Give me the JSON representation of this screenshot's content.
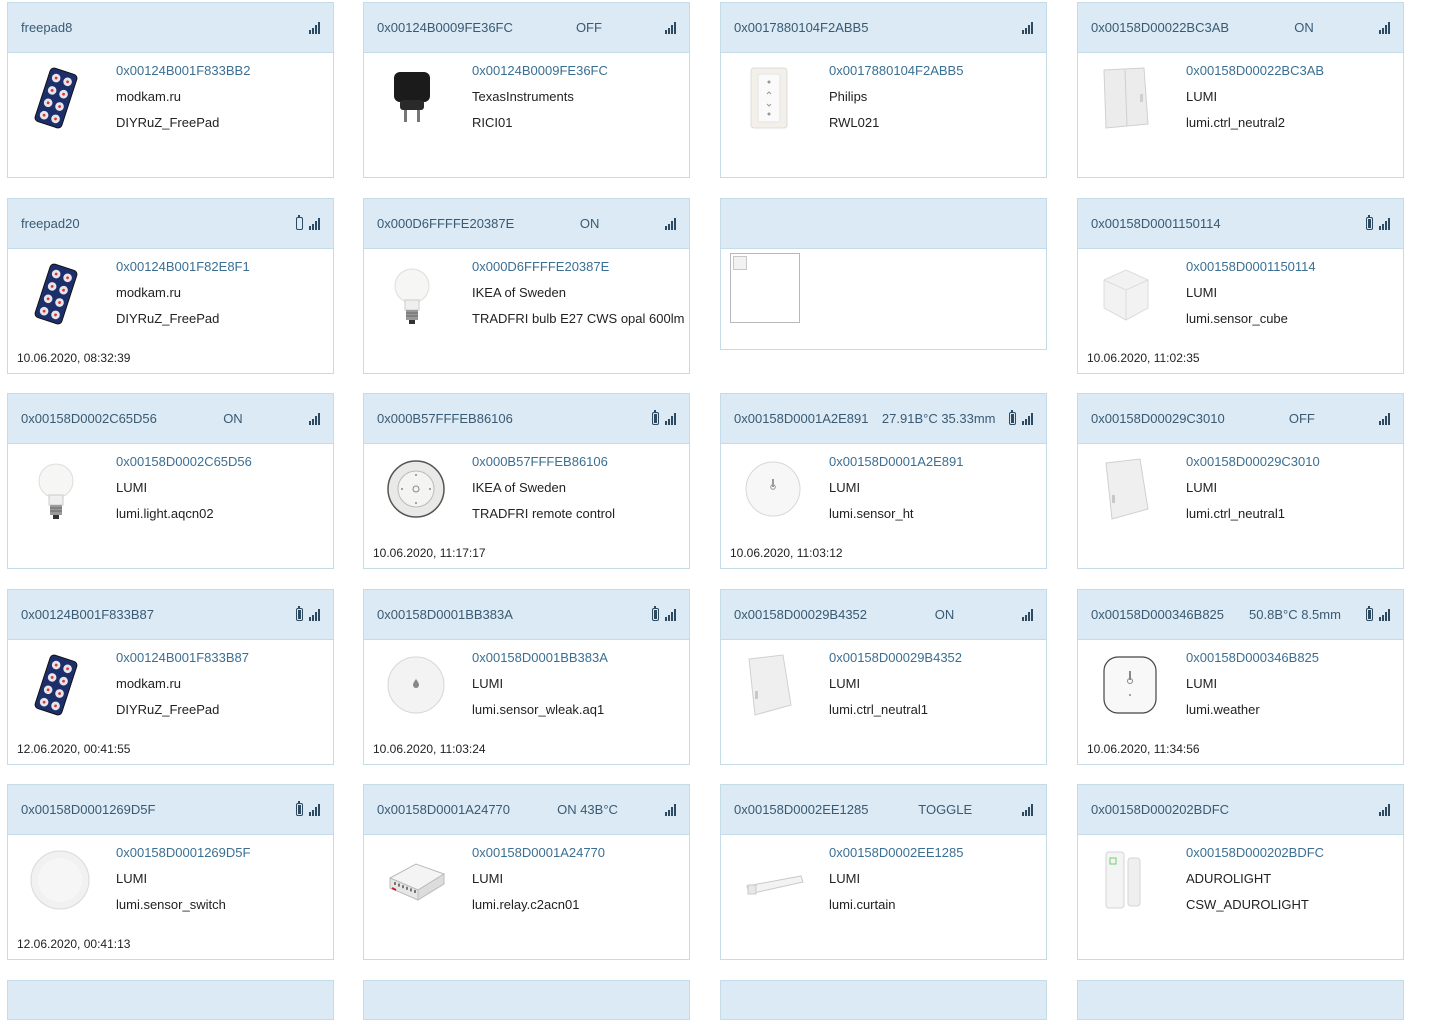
{
  "cards": [
    {
      "title": "freepad8",
      "state": "",
      "battery": "",
      "ieee": "0x00124B001F833BB2",
      "vendor": "modkam.ru",
      "model": "DIYRuZ_FreePad",
      "date": "",
      "img": "freepad-icon"
    },
    {
      "title": "0x00124B0009FE36FC",
      "state": "OFF",
      "battery": "",
      "ieee": "0x00124B0009FE36FC",
      "vendor": "TexasInstruments",
      "model": "RICI01",
      "date": "",
      "img": "plug-icon"
    },
    {
      "title": "0x0017880104F2ABB5",
      "state": "",
      "battery": "",
      "ieee": "0x0017880104F2ABB5",
      "vendor": "Philips",
      "model": "RWL021",
      "date": "",
      "img": "dimmer-icon"
    },
    {
      "title": "0x00158D00022BC3AB",
      "state": "ON",
      "battery": "",
      "ieee": "0x00158D00022BC3AB",
      "vendor": "LUMI",
      "model": "lumi.ctrl_neutral2",
      "date": "",
      "img": "double-switch-icon"
    },
    {
      "title": "freepad20",
      "state": "",
      "battery": "empty",
      "ieee": "0x00124B001F82E8F1",
      "vendor": "modkam.ru",
      "model": "DIYRuZ_FreePad",
      "date": "10.06.2020, 08:32:39",
      "img": "freepad-icon"
    },
    {
      "title": "0x000D6FFFFE20387E",
      "state": "ON",
      "battery": "",
      "ieee": "0x000D6FFFFE20387E",
      "vendor": "IKEA of Sweden",
      "model": "TRADFRI bulb E27 CWS opal 600lm",
      "date": "",
      "img": "bulb-icon"
    },
    {
      "title": "",
      "state": "",
      "battery": "",
      "ieee": "",
      "vendor": "",
      "model": "",
      "date": "",
      "img": "broken-image-icon"
    },
    {
      "title": "0x00158D0001150114",
      "state": "",
      "battery": "full",
      "ieee": "0x00158D0001150114",
      "vendor": "LUMI",
      "model": "lumi.sensor_cube",
      "date": "10.06.2020, 11:02:35",
      "img": "cube-icon"
    },
    {
      "title": "0x00158D0002C65D56",
      "state": "ON",
      "battery": "",
      "ieee": "0x00158D0002C65D56",
      "vendor": "LUMI",
      "model": "lumi.light.aqcn02",
      "date": "",
      "img": "bulb-icon"
    },
    {
      "title": "0x000B57FFFEB86106",
      "state": "",
      "battery": "half",
      "ieee": "0x000B57FFFEB86106",
      "vendor": "IKEA of Sweden",
      "model": "TRADFRI remote control",
      "date": "10.06.2020, 11:17:17",
      "img": "remote-icon"
    },
    {
      "title": "0x00158D0001A2E891",
      "state": "27.91B°C 35.33mm",
      "battery": "half",
      "ieee": "0x00158D0001A2E891",
      "vendor": "LUMI",
      "model": "lumi.sensor_ht",
      "date": "10.06.2020, 11:03:12",
      "img": "round-sensor-icon"
    },
    {
      "title": "0x00158D00029C3010",
      "state": "OFF",
      "battery": "",
      "ieee": "0x00158D00029C3010",
      "vendor": "LUMI",
      "model": "lumi.ctrl_neutral1",
      "date": "",
      "img": "single-switch-icon"
    },
    {
      "title": "0x00124B001F833B87",
      "state": "",
      "battery": "half",
      "ieee": "0x00124B001F833B87",
      "vendor": "modkam.ru",
      "model": "DIYRuZ_FreePad",
      "date": "12.06.2020, 00:41:55",
      "img": "freepad-icon"
    },
    {
      "title": "0x00158D0001BB383A",
      "state": "",
      "battery": "full",
      "ieee": "0x00158D0001BB383A",
      "vendor": "LUMI",
      "model": "lumi.sensor_wleak.aq1",
      "date": "10.06.2020, 11:03:24",
      "img": "leak-sensor-icon"
    },
    {
      "title": "0x00158D00029B4352",
      "state": "ON",
      "battery": "",
      "ieee": "0x00158D00029B4352",
      "vendor": "LUMI",
      "model": "lumi.ctrl_neutral1",
      "date": "",
      "img": "single-switch-icon"
    },
    {
      "title": "0x00158D000346B825",
      "state": "50.8B°C 8.5mm",
      "battery": "full",
      "ieee": "0x00158D000346B825",
      "vendor": "LUMI",
      "model": "lumi.weather",
      "date": "10.06.2020, 11:34:56",
      "img": "weather-sensor-icon"
    },
    {
      "title": "0x00158D0001269D5F",
      "state": "",
      "battery": "full",
      "ieee": "0x00158D0001269D5F",
      "vendor": "LUMI",
      "model": "lumi.sensor_switch",
      "date": "12.06.2020, 00:41:13",
      "img": "round-button-icon"
    },
    {
      "title": "0x00158D0001A24770",
      "state": "ON 43B°C",
      "battery": "",
      "ieee": "0x00158D0001A24770",
      "vendor": "LUMI",
      "model": "lumi.relay.c2acn01",
      "date": "",
      "img": "relay-icon"
    },
    {
      "title": "0x00158D0002EE1285",
      "state": "TOGGLE",
      "battery": "",
      "ieee": "0x00158D0002EE1285",
      "vendor": "LUMI",
      "model": "lumi.curtain",
      "date": "",
      "img": "curtain-icon"
    },
    {
      "title": "0x00158D000202BDFC",
      "state": "",
      "battery": "",
      "ieee": "0x00158D000202BDFC",
      "vendor": "ADUROLIGHT",
      "model": "CSW_ADUROLIGHT",
      "date": "",
      "img": "door-sensor-icon"
    }
  ],
  "colors": {
    "header_bg": "#dbeaf4",
    "border": "#c5dbe8",
    "ieee_text": "#3a6f93",
    "header_text": "#3a5a73"
  }
}
